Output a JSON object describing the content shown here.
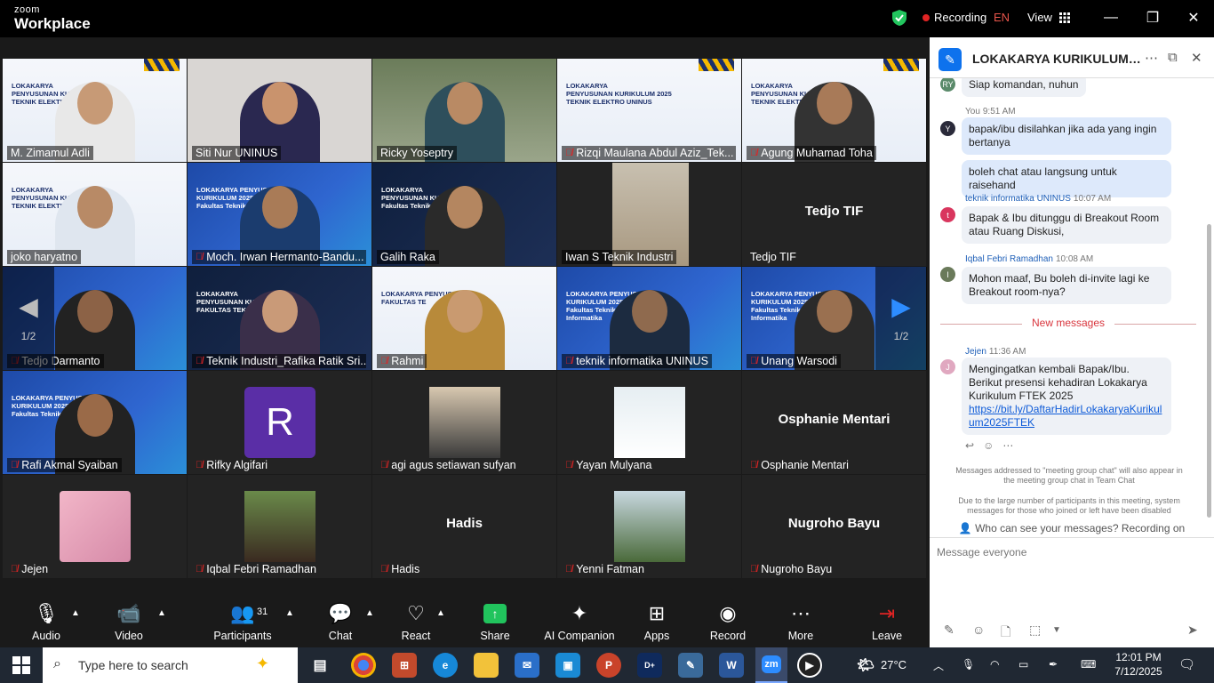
{
  "titlebar": {
    "logo_top": "zoom",
    "logo_bottom": "Workplace",
    "recording": "Recording",
    "language": "EN",
    "view": "View"
  },
  "grid": {
    "page_left": "1/2",
    "page_right": "1/2",
    "tiles": [
      {
        "name": "M. Zimamul Adli",
        "muted": false
      },
      {
        "name": "Siti Nur UNINUS",
        "muted": false
      },
      {
        "name": "Ricky Yoseptry",
        "muted": false
      },
      {
        "name": "Rizqi Maulana Abdul Aziz_Tek...",
        "muted": true
      },
      {
        "name": "Agung Muhamad Toha",
        "muted": true
      },
      {
        "name": "joko haryatno",
        "muted": false
      },
      {
        "name": "Moch. Irwan Hermanto-Bandu...",
        "muted": true
      },
      {
        "name": "Galih Raka",
        "muted": false
      },
      {
        "name": "Iwan S Teknik Industri",
        "muted": false
      },
      {
        "name": "Tedjo TIF",
        "muted": false,
        "center": "Tedjo TIF"
      },
      {
        "name": "Tedjo Darmanto",
        "muted": true
      },
      {
        "name": "Teknik Industri_Rafika Ratik Sri...",
        "muted": true
      },
      {
        "name": "Rahmi",
        "muted": true
      },
      {
        "name": "teknik informatika UNINUS",
        "muted": true
      },
      {
        "name": "Unang Warsodi",
        "muted": true
      },
      {
        "name": "Rafi Akmal Syaiban",
        "muted": true
      },
      {
        "name": "Rifky Algifari",
        "muted": true,
        "letter": "R"
      },
      {
        "name": "agi agus setiawan sufyan",
        "muted": true
      },
      {
        "name": "Yayan Mulyana",
        "muted": true
      },
      {
        "name": "Osphanie Mentari",
        "muted": true,
        "center": "Osphanie Mentari"
      },
      {
        "name": "Jejen",
        "muted": true
      },
      {
        "name": "Iqbal Febri Ramadhan",
        "muted": true
      },
      {
        "name": "Hadis",
        "muted": true,
        "center": "Hadis"
      },
      {
        "name": "Yenni Fatman",
        "muted": true
      },
      {
        "name": "Nugroho Bayu",
        "muted": true,
        "center": "Nugroho Bayu"
      }
    ]
  },
  "toolbar": {
    "audio": "Audio",
    "video": "Video",
    "participants": "Participants",
    "participants_count": "31",
    "chat": "Chat",
    "react": "React",
    "share": "Share",
    "ai": "AI Companion",
    "apps": "Apps",
    "record": "Record",
    "more": "More",
    "leave": "Leave"
  },
  "chat": {
    "title": "LOKAKARYA KURIKULUM FA...",
    "msg0": "Siap komandan, nuhun",
    "you_label": "You",
    "you_time": "9:51 AM",
    "msg1": "bapak/ibu disilahkan jika ada yang ingin bertanya",
    "msg2": "boleh chat atau langsung untuk raisehand",
    "s3_name": "teknik informatika UNINUS",
    "s3_time": "10:07 AM",
    "s3_avatar": "t",
    "msg3": "Bapak & Ibu ditunggu di Breakout Room atau Ruang Diskusi,",
    "s4_name": "Iqbal Febri Ramadhan",
    "s4_time": "10:08 AM",
    "msg4": "Mohon maaf, Bu boleh di-invite lagi ke Breakout room-nya?",
    "new_messages": "New messages",
    "s5_name": "Jejen",
    "s5_time": "11:36 AM",
    "msg5": "Mengingatkan kembali Bapak/Ibu. Berikut presensi kehadiran Lokakarya Kurikulum FTEK 2025",
    "msg5_link": "https://bit.ly/DaftarHadirLokakaryaKurikulum2025FTEK",
    "sys1": "Messages addressed to \"meeting group chat\" will also appear in the meeting group chat in Team Chat",
    "sys2": "Due to the large number of participants in this meeting, system messages for those who joined or left have been disabled",
    "who": "Who can see your messages? Recording on",
    "placeholder": "Message everyone"
  },
  "taskbar": {
    "search": "Type here to search",
    "weather": "27°C",
    "time": "12:01 PM",
    "date": "7/12/2025"
  }
}
